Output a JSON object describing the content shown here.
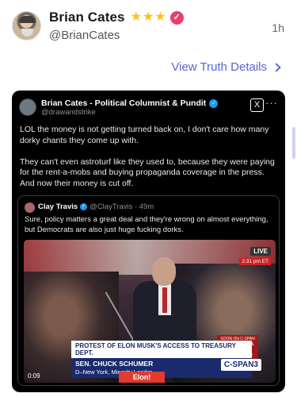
{
  "post": {
    "display_name": "Brian Cates",
    "stars": [
      "★",
      "★",
      "★"
    ],
    "verified_glyph": "✓",
    "handle": "@BrianCates",
    "timestamp": "1h",
    "details_link": "View Truth Details"
  },
  "embed": {
    "author": "Brian Cates - Political Columnist & Pundit",
    "handle": "@drawandstrike",
    "verified_glyph": "✓",
    "x_logo": "X",
    "more_glyph": "···",
    "paragraphs": [
      "LOL the money is not getting turned back on, I don't care how many dorky chants they come up with.",
      "They can't even astroturf like they used to, because they were paying for the rent-a-mobs and buying propaganda coverage in the press.  And now their money is cut off."
    ],
    "quote": {
      "author": "Clay Travis",
      "handle": "@ClayTravis · 49m",
      "verified_glyph": "✓",
      "text": "Sure, policy matters a great deal and they're wrong on almost everything, but Democrats are also just huge fucking dorks.",
      "video": {
        "live_label": "LIVE",
        "live_time": "2:31 pm ET",
        "headline": "PROTEST OF ELON MUSK'S ACCESS TO TREASURY DEPT.",
        "speaker_name": "SEN. CHUCK SCHUMER",
        "speaker_title": "D–New York, Minority Leader",
        "side_box": "SOON ON C-SPAN President Trump & Israeli PM Netanyahu News Conference",
        "network_logo": "C-SPAN3",
        "sign_text": "Elon!",
        "elapsed": "0:09"
      }
    }
  },
  "colors": {
    "accent_link": "#5865d6",
    "star": "#f5c518",
    "badge": "#ea3f6b",
    "embed_bg": "#000000"
  },
  "icons": [
    "avatar",
    "star-icon",
    "verified-badge-icon",
    "chevron-right-icon",
    "x-logo-icon",
    "more-icon"
  ]
}
